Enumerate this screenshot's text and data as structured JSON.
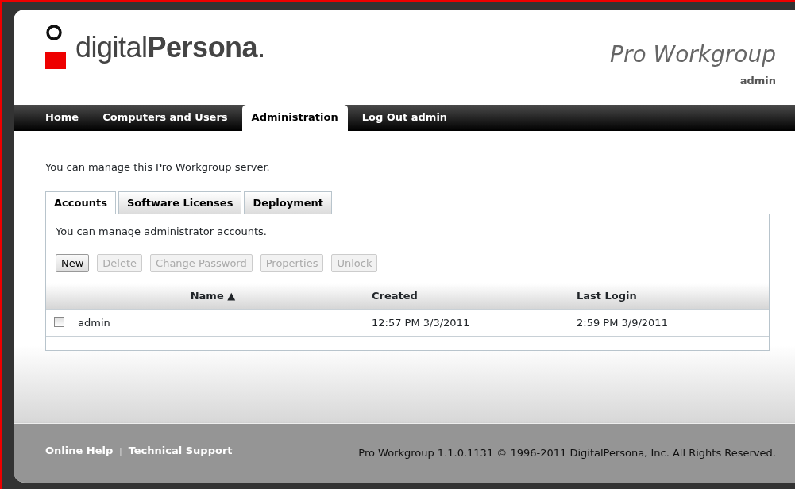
{
  "header": {
    "logo_text": "digital**Persona**.",
    "product": "Pro Workgroup",
    "user": "admin"
  },
  "nav": [
    {
      "label": "Home",
      "selected": false
    },
    {
      "label": "Computers and Users",
      "selected": false
    },
    {
      "label": "Administration",
      "selected": true
    },
    {
      "label": "Log Out admin",
      "selected": false
    }
  ],
  "intro": "You can manage this Pro Workgroup server.",
  "tabs": [
    {
      "label": "Accounts",
      "selected": true
    },
    {
      "label": "Software Licenses",
      "selected": false
    },
    {
      "label": "Deployment",
      "selected": false
    }
  ],
  "panel_text": "You can manage administrator accounts.",
  "buttons": [
    {
      "label": "New",
      "disabled": false
    },
    {
      "label": "Delete",
      "disabled": true
    },
    {
      "label": "Change Password",
      "disabled": true
    },
    {
      "label": "Properties",
      "disabled": true
    },
    {
      "label": "Unlock",
      "disabled": true
    }
  ],
  "table": {
    "columns": [
      {
        "label": "Name",
        "sort": "▲"
      },
      {
        "label": "Created"
      },
      {
        "label": "Last Login"
      }
    ],
    "rows": [
      {
        "checked": false,
        "cells": [
          "admin",
          "12:57 PM 3/3/2011",
          "2:59 PM 3/9/2011"
        ]
      }
    ]
  },
  "footer": {
    "links": [
      "Online Help",
      "Technical Support"
    ],
    "separator": "|",
    "copyright": "Pro Workgroup 1.1.0.1131 © 1996-2011 DigitalPersona, Inc. All Rights Reserved."
  }
}
